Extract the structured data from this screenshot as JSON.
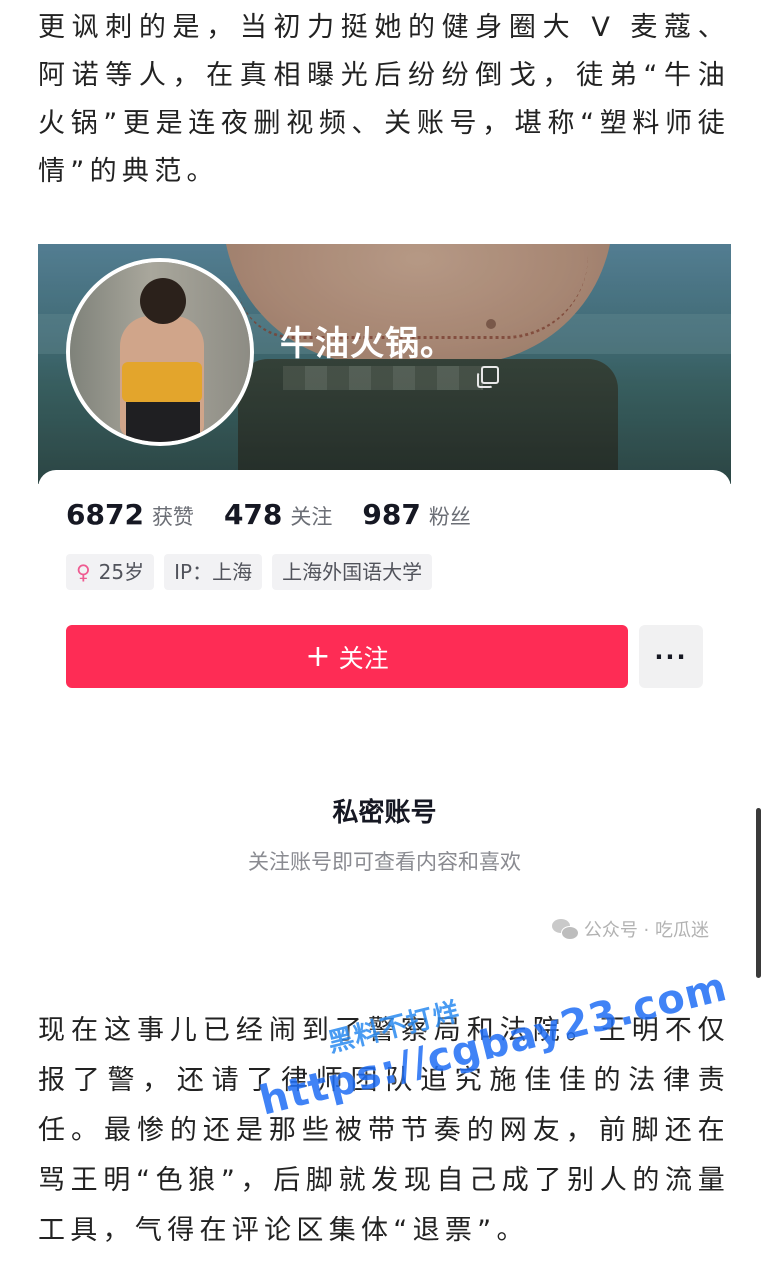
{
  "article": {
    "paragraph_top": "更讽刺的是，当初力挺她的健身圈大 V 麦蔻、阿诺等人，在真相曝光后纷纷倒戈，徒弟“牛油火锅”更是连夜删视频、关账号，堪称“塑料师徒情”的典范。",
    "paragraph_bottom": "现在这事儿已经闹到了警察局和法院。王明不仅报了警，还请了律师团队追究施佳佳的法律责任。最惨的还是那些被带节奏的网友，前脚还在骂王明“色狼”，后脚就发现自己成了别人的流量工具，气得在评论区集体“退票”。"
  },
  "profile": {
    "name": "牛油火锅。",
    "stats": [
      {
        "value": "6872",
        "label": "获赞"
      },
      {
        "value": "478",
        "label": "关注"
      },
      {
        "value": "987",
        "label": "粉丝"
      }
    ],
    "tags": [
      {
        "icon": "female-icon",
        "text": "25岁"
      },
      {
        "text": "IP：上海"
      },
      {
        "text": "上海外国语大学"
      }
    ],
    "follow_label": "关注",
    "more_label": "···",
    "private_title": "私密账号",
    "private_subtitle": "关注账号即可查看内容和喜欢"
  },
  "watermarks": {
    "wechat_source": "公众号 · 吃瓜迷",
    "site_line1": "黑料不打烊",
    "site_line2": "https://cgbay23.com"
  },
  "colors": {
    "follow_button": "#fe2c55",
    "page_background": "#ffffff"
  }
}
